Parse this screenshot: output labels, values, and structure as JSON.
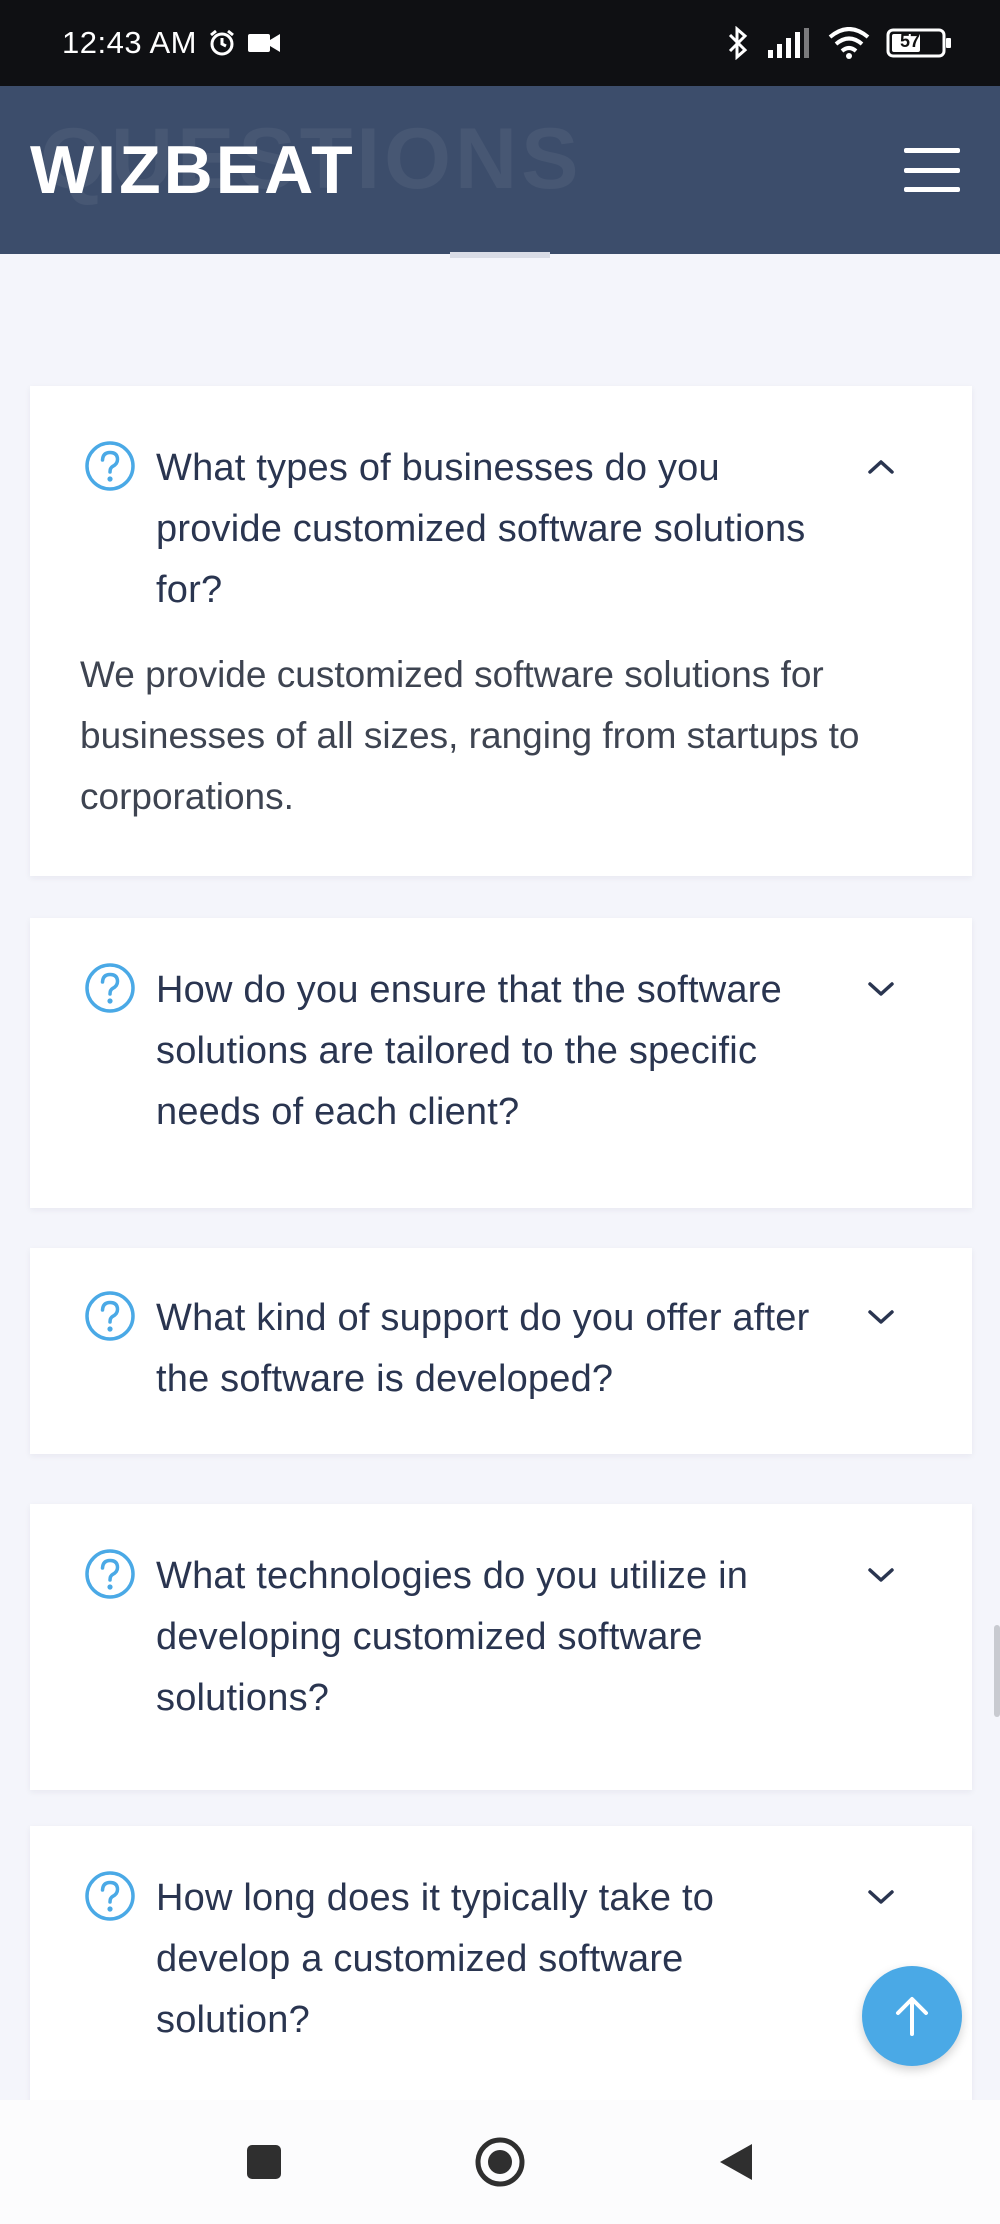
{
  "status_bar": {
    "time": "12:43 AM",
    "battery": "57",
    "icons": [
      "alarm-icon",
      "video-record-icon",
      "bluetooth-icon",
      "signal-icon",
      "wifi-icon",
      "battery-icon"
    ]
  },
  "header": {
    "brand": "WIZBEAT",
    "ghost_title": "QUESTIONS",
    "menu_icon": "hamburger-menu-icon",
    "background_color": "#3c4d6b"
  },
  "faq": {
    "accent_color": "#4aa9e6",
    "items": [
      {
        "question": "What types of businesses do you provide customized software solutions for?",
        "expanded": true,
        "answer": "We provide customized software solutions for businesses of all sizes, ranging from startups to corporations."
      },
      {
        "question": "How do you ensure that the software solutions are tailored to the specific needs of each client?",
        "expanded": false
      },
      {
        "question": "What kind of support do you offer after the software is developed?",
        "expanded": false
      },
      {
        "question": "What technologies do you utilize in developing customized software solutions?",
        "expanded": false
      },
      {
        "question": "How long does it typically take to develop a customized software solution?",
        "expanded": false
      }
    ]
  },
  "back_to_top": {
    "icon": "arrow-up-icon"
  },
  "nav_bar": {
    "buttons": [
      "recent-apps-icon",
      "home-icon",
      "back-icon"
    ]
  }
}
